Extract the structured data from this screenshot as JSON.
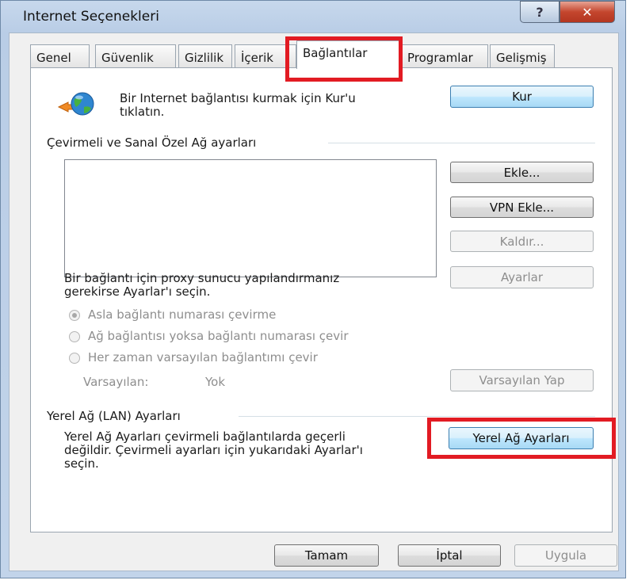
{
  "window": {
    "title": "Internet Seçenekleri",
    "help_label": "?",
    "close_label": "✕"
  },
  "tabs": [
    "Genel",
    "Güvenlik",
    "Gizlilik",
    "İçerik",
    "Bağlantılar",
    "Programlar",
    "Gelişmiş"
  ],
  "active_tab": "Bağlantılar",
  "setup": {
    "text_line1": "Bir Internet bağlantısı kurmak için Kur'u",
    "text_line2": "tıklatın.",
    "button": "Kur"
  },
  "dialup": {
    "group_title": "Çevirmeli ve Sanal Özel Ağ ayarları",
    "add_button": "Ekle...",
    "add_vpn_button": "VPN Ekle...",
    "remove_button": "Kaldır...",
    "proxy_text_line1": "Bir bağlantı için proxy sunucu yapılandırmanız",
    "proxy_text_line2": "gerekirse Ayarlar'ı seçin.",
    "settings_button": "Ayarlar",
    "radio_options": [
      "Asla bağlantı numarası çevirme",
      "Ağ bağlantısı yoksa bağlantı numarası çevir",
      "Her zaman varsayılan bağlantımı çevir"
    ],
    "selected_radio": "Asla bağlantı numarası çevirme",
    "default_label": "Varsayılan:",
    "default_value": "Yok",
    "set_default_button": "Varsayılan Yap"
  },
  "lan": {
    "group_title": "Yerel Ağ (LAN) Ayarları",
    "text_line1": "Yerel Ağ Ayarları çevirmeli bağlantılarda geçerli",
    "text_line2": "değildir. Çevirmeli ayarları için yukarıdaki Ayarlar'ı",
    "text_line3": "seçin.",
    "button": "Yerel Ağ Ayarları"
  },
  "footer": {
    "ok_button": "Tamam",
    "cancel_button": "İptal",
    "apply_button": "Uygula"
  },
  "colors": {
    "highlight": "#e21b23",
    "title_bar": "#b9cde6",
    "close_button": "#c4462e"
  }
}
